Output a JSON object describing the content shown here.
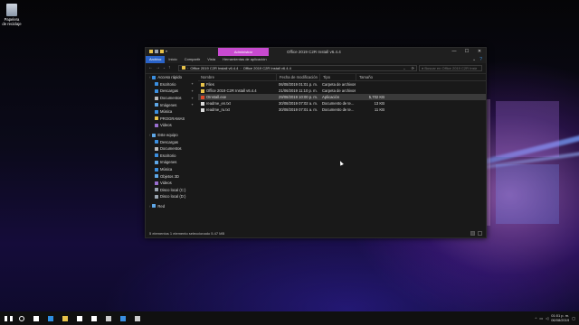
{
  "desktop": {
    "recycle_bin_label": "Papelera de reciclaje"
  },
  "window": {
    "title": "Office 2019 C2R Install v6.4.4",
    "contextual_tab": "Administrar",
    "ribbon_tabs": [
      "Archivo",
      "Inicio",
      "Compartir",
      "Vista",
      "Herramientas de aplicación"
    ],
    "active_ribbon_tab": "Archivo",
    "minimize": "—",
    "maximize": "☐",
    "close": "✕"
  },
  "address": {
    "breadcrumb": [
      "Office 2019 C2R Install v6.4.4",
      "Office 2019 C2R Install v6.4.4"
    ],
    "search_placeholder": "Buscar en Office 2019 C2R Install v6.4.4"
  },
  "sidebar": {
    "items": [
      {
        "label": "Acceso rápido",
        "kind": "group",
        "icon": "star-icon",
        "color": "#3b8fe0"
      },
      {
        "label": "Escritorio",
        "kind": "sub",
        "icon": "desktop-icon",
        "color": "#3b8fe0",
        "pinned": true
      },
      {
        "label": "Descargas",
        "kind": "sub",
        "icon": "download-icon",
        "color": "#3b8fe0",
        "pinned": true
      },
      {
        "label": "Documentos",
        "kind": "sub",
        "icon": "documents-icon",
        "color": "#bbbbbb",
        "pinned": true
      },
      {
        "label": "Imágenes",
        "kind": "sub",
        "icon": "pictures-icon",
        "color": "#5fa8e8",
        "pinned": true
      },
      {
        "label": "Música",
        "kind": "sub",
        "icon": "music-icon",
        "color": "#3b8fe0"
      },
      {
        "label": "PROGRAMAS",
        "kind": "sub",
        "icon": "folder-icon",
        "color": "#e8c34a"
      },
      {
        "label": "Videos",
        "kind": "sub",
        "icon": "videos-icon",
        "color": "#9a6fd0"
      },
      {
        "label": "",
        "kind": "spacer"
      },
      {
        "label": "Este equipo",
        "kind": "group",
        "icon": "computer-icon",
        "color": "#5fa8e8"
      },
      {
        "label": "Descargas",
        "kind": "sub",
        "icon": "download-icon",
        "color": "#3b8fe0"
      },
      {
        "label": "Documentos",
        "kind": "sub",
        "icon": "documents-icon",
        "color": "#bbbbbb"
      },
      {
        "label": "Escritorio",
        "kind": "sub",
        "icon": "desktop-icon",
        "color": "#3b8fe0"
      },
      {
        "label": "Imágenes",
        "kind": "sub",
        "icon": "pictures-icon",
        "color": "#5fa8e8"
      },
      {
        "label": "Música",
        "kind": "sub",
        "icon": "music-icon",
        "color": "#3b8fe0"
      },
      {
        "label": "Objetos 3D",
        "kind": "sub",
        "icon": "cube-icon",
        "color": "#5fa8e8"
      },
      {
        "label": "Videos",
        "kind": "sub",
        "icon": "videos-icon",
        "color": "#9a6fd0"
      },
      {
        "label": "Disco local (C:)",
        "kind": "sub",
        "icon": "drive-icon",
        "color": "#9aa4b0"
      },
      {
        "label": "Disco local (D:)",
        "kind": "sub",
        "icon": "drive-icon",
        "color": "#9aa4b0"
      },
      {
        "label": "",
        "kind": "spacer"
      },
      {
        "label": "Red",
        "kind": "group",
        "icon": "network-icon",
        "color": "#5fa8e8"
      }
    ]
  },
  "file_list": {
    "columns": [
      "Nombre",
      "Fecha de modificación",
      "Tipo",
      "Tamaño"
    ],
    "rows": [
      {
        "name": "Files",
        "date": "06/08/2019 01:01 p. m.",
        "type": "Carpeta de archivos",
        "size": "",
        "icon": "folder-icon",
        "color": "#e8c34a",
        "selected": false
      },
      {
        "name": "Office 2019 C2R Install v6.4.4",
        "date": "21/06/2019 11:10 p. m.",
        "type": "Carpeta de archivos",
        "size": "",
        "icon": "folder-icon",
        "color": "#e8c34a",
        "selected": false
      },
      {
        "name": "OInstall.exe",
        "date": "29/08/2019 10:00 p. m.",
        "type": "Aplicación",
        "size": "5,702 KB",
        "icon": "app-icon",
        "color": "#e04a2a",
        "selected": true
      },
      {
        "name": "readme_en.txt",
        "date": "30/08/2019 07:02 a. m.",
        "type": "Documento de te...",
        "size": "13 KB",
        "icon": "text-file-icon",
        "color": "#dddddd",
        "selected": false
      },
      {
        "name": "readme_ru.txt",
        "date": "30/08/2019 07:01 a. m.",
        "type": "Documento de te...",
        "size": "11 KB",
        "icon": "text-file-icon",
        "color": "#dddddd",
        "selected": false
      }
    ]
  },
  "status_bar": {
    "text": "5 elementos   1 elemento seleccionado 5.47 MB"
  },
  "taskbar": {
    "apps": [
      {
        "icon": "windows-start-icon",
        "color": "#ffffff"
      },
      {
        "icon": "search-icon",
        "color": "#ffffff"
      },
      {
        "icon": "task-view-icon",
        "color": "#ffffff"
      },
      {
        "icon": "edge-icon",
        "color": "#2f8fe0"
      },
      {
        "icon": "file-explorer-icon",
        "color": "#e8c34a"
      },
      {
        "icon": "store-icon",
        "color": "#ffffff"
      },
      {
        "icon": "mail-icon",
        "color": "#ffffff"
      },
      {
        "icon": "app-icon",
        "color": "#cccccc"
      },
      {
        "icon": "app-icon",
        "color": "#3a8fe0"
      },
      {
        "icon": "app-icon",
        "color": "#cccccc"
      }
    ],
    "time": "01:01 p. m.",
    "date": "06/08/2019"
  }
}
